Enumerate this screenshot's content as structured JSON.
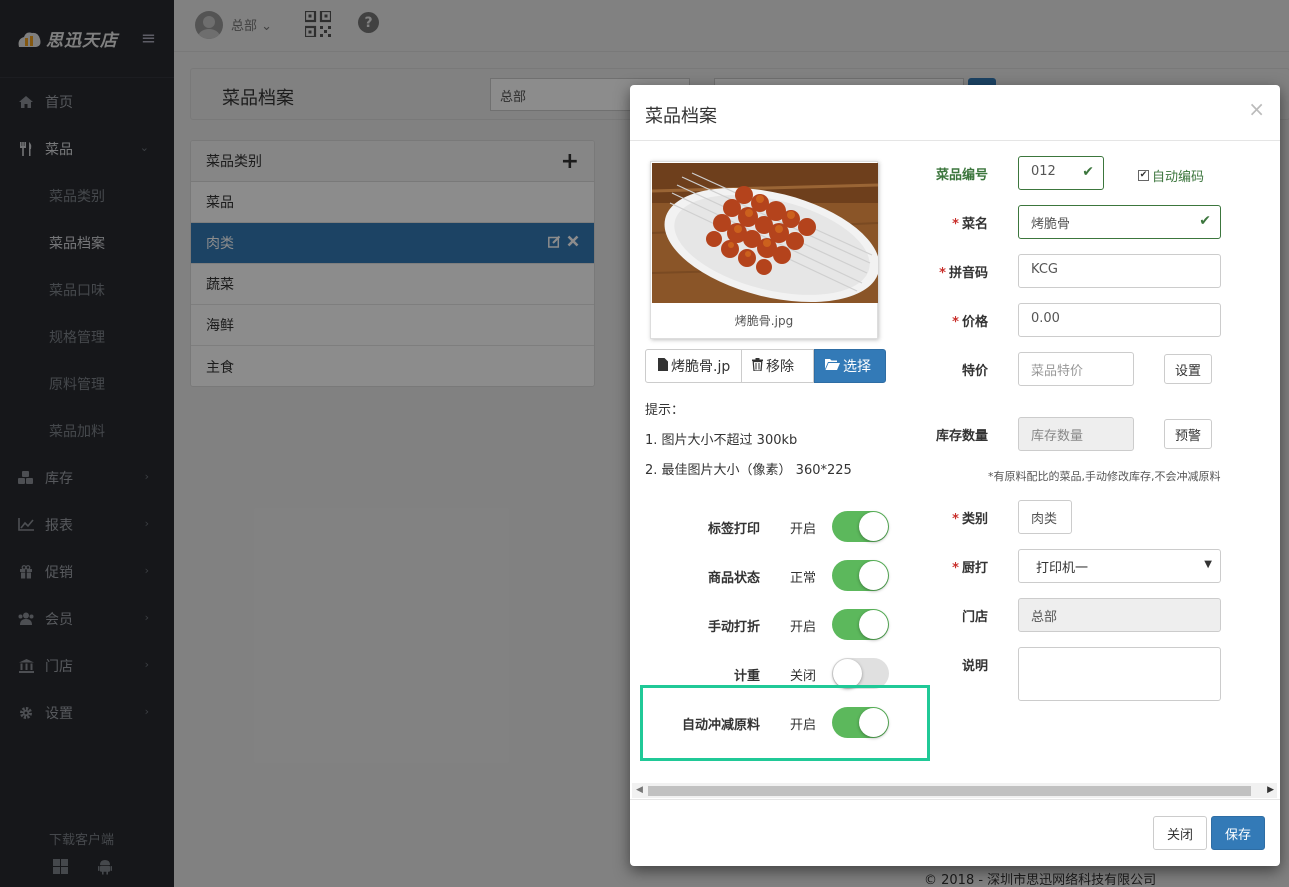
{
  "brand": {
    "name": "思迅天店"
  },
  "sidebar": {
    "items": [
      {
        "label": "首页",
        "icon": "home-icon"
      },
      {
        "label": "菜品",
        "icon": "cutlery-icon",
        "expanded": true,
        "children": [
          {
            "label": "菜品类别"
          },
          {
            "label": "菜品档案",
            "active": true
          },
          {
            "label": "菜品口味"
          },
          {
            "label": "规格管理"
          },
          {
            "label": "原料管理"
          },
          {
            "label": "菜品加料"
          }
        ]
      },
      {
        "label": "库存",
        "icon": "cubes-icon"
      },
      {
        "label": "报表",
        "icon": "line-chart-icon"
      },
      {
        "label": "促销",
        "icon": "gift-icon"
      },
      {
        "label": "会员",
        "icon": "users-icon"
      },
      {
        "label": "门店",
        "icon": "bank-icon"
      },
      {
        "label": "设置",
        "icon": "gear-icon"
      }
    ],
    "download": "下载客户端"
  },
  "topbar": {
    "user": "总部"
  },
  "page": {
    "title": "菜品档案",
    "store": "总部",
    "categories": {
      "header": "菜品类别",
      "rows": [
        "菜品",
        "肉类",
        "蔬菜",
        "海鲜",
        "主食"
      ]
    },
    "footer": "© 2018 - 深圳市思迅网络科技有限公司"
  },
  "modal": {
    "title": "菜品档案",
    "close_glyph": "×",
    "image_caption": "烤脆骨.jpg",
    "file_name": "烤脆骨.jp",
    "remove_label": "移除",
    "choose_label": "选择",
    "tips_title": "提示：",
    "tip1": "1. 图片大小不超过 300kb",
    "tip2": "2. 最佳图片大小（像素） 360*225",
    "switches": [
      {
        "label": "标签打印",
        "state": "开启",
        "on": true
      },
      {
        "label": "商品状态",
        "state": "正常",
        "on": true
      },
      {
        "label": "手动打折",
        "state": "开启",
        "on": true
      },
      {
        "label": "计重",
        "state": "关闭",
        "on": false
      },
      {
        "label": "自动冲减原料",
        "state": "开启",
        "on": true
      }
    ],
    "fields": {
      "code_label": "菜品编号",
      "code_value": "012",
      "auto_code": "自动编码",
      "name_label": "菜名",
      "name_value": "烤脆骨",
      "pinyin_label": "拼音码",
      "pinyin_value": "KCG",
      "price_label": "价格",
      "price_value": "0.00",
      "special_label": "特价",
      "special_placeholder": "菜品特价",
      "special_btn": "设置",
      "stock_label": "库存数量",
      "stock_placeholder": "库存数量",
      "stock_btn": "预警",
      "stock_note": "*有原料配比的菜品,手动修改库存,不会冲减原料",
      "category_label": "类别",
      "category_value": "肉类",
      "printer_label": "厨打",
      "printer_value": "打印机一",
      "store_label": "门店",
      "store_value": "总部",
      "desc_label": "说明"
    },
    "close_btn": "关闭",
    "save_btn": "保存"
  },
  "colors": {
    "primary": "#337ab7",
    "success": "#5cb85c",
    "highlight": "#20c997",
    "sidebar": "#282b30"
  }
}
